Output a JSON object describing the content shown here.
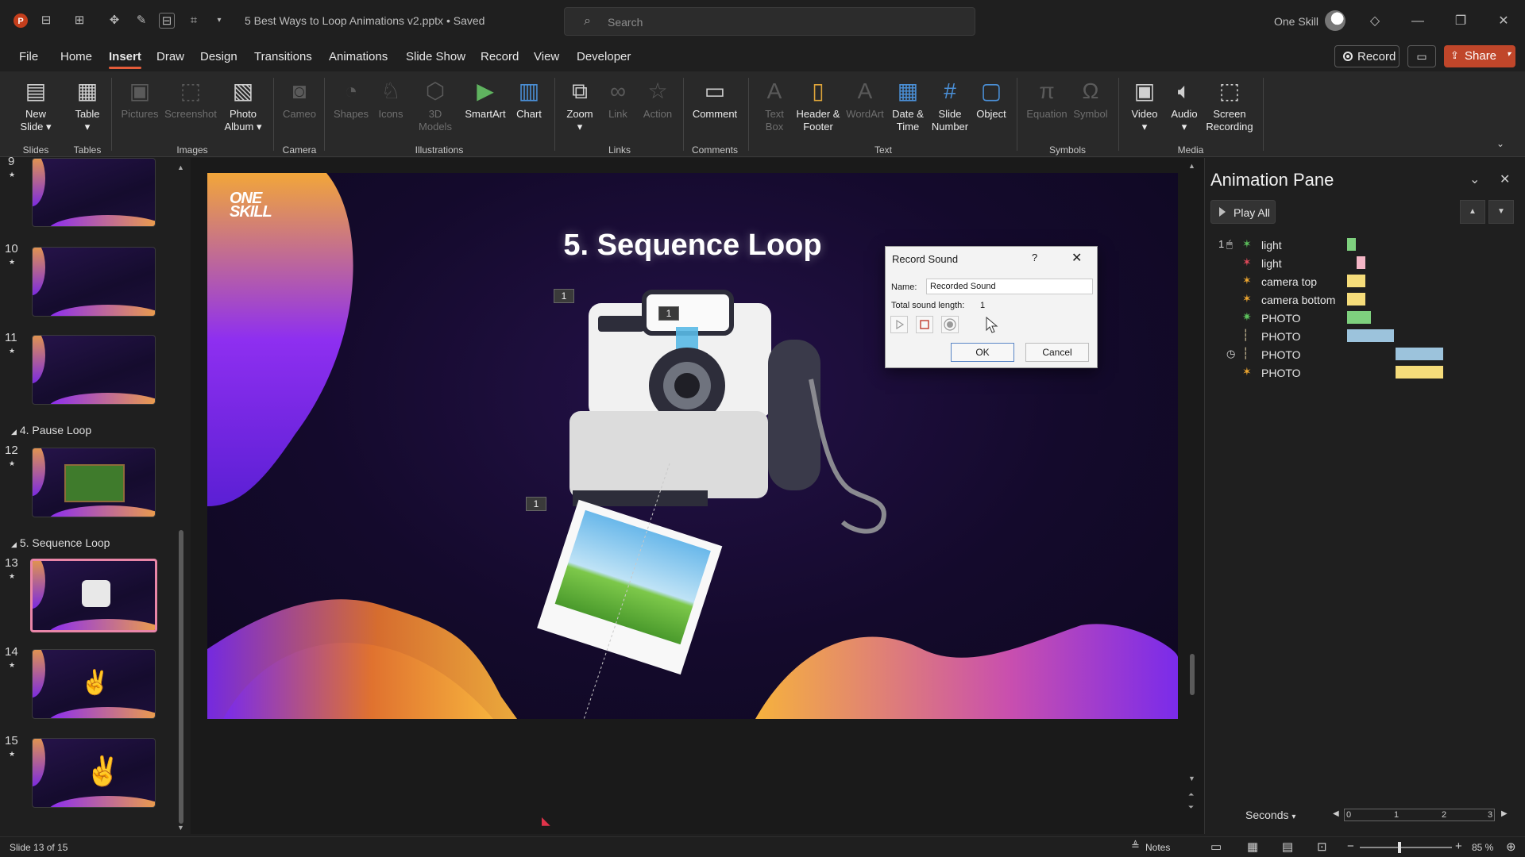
{
  "app": {
    "title": "5 Best Ways to Loop Animations v2.pptx • Saved",
    "search_placeholder": "Search",
    "user": "One Skill"
  },
  "menu": {
    "tabs": [
      "File",
      "Home",
      "Insert",
      "Draw",
      "Design",
      "Transitions",
      "Animations",
      "Slide Show",
      "Record",
      "View",
      "Developer"
    ],
    "active": "Insert",
    "record_label": "Record",
    "share_label": "Share"
  },
  "ribbon": {
    "buttons": [
      {
        "label": "New Slide",
        "icon": "new-slide-icon",
        "enabled": true
      },
      {
        "label": "Table",
        "icon": "table-icon",
        "enabled": true
      },
      {
        "label": "Pictures",
        "icon": "pictures-icon",
        "enabled": false
      },
      {
        "label": "Screenshot",
        "icon": "screenshot-icon",
        "enabled": false
      },
      {
        "label": "Photo Album",
        "icon": "photo-album-icon",
        "enabled": true
      },
      {
        "label": "Cameo",
        "icon": "cameo-icon",
        "enabled": false
      },
      {
        "label": "Shapes",
        "icon": "shapes-icon",
        "enabled": false
      },
      {
        "label": "Icons",
        "icon": "icons-icon",
        "enabled": false
      },
      {
        "label": "3D Models",
        "icon": "3d-models-icon",
        "enabled": false
      },
      {
        "label": "SmartArt",
        "icon": "smartart-icon",
        "enabled": true
      },
      {
        "label": "Chart",
        "icon": "chart-icon",
        "enabled": true
      },
      {
        "label": "Zoom",
        "icon": "zoom-icon",
        "enabled": true
      },
      {
        "label": "Link",
        "icon": "link-icon",
        "enabled": false
      },
      {
        "label": "Action",
        "icon": "action-icon",
        "enabled": false
      },
      {
        "label": "Comment",
        "icon": "comment-icon",
        "enabled": true
      },
      {
        "label": "Text Box",
        "icon": "text-box-icon",
        "enabled": false
      },
      {
        "label": "Header & Footer",
        "icon": "header-footer-icon",
        "enabled": true
      },
      {
        "label": "WordArt",
        "icon": "wordart-icon",
        "enabled": false
      },
      {
        "label": "Date & Time",
        "icon": "date-time-icon",
        "enabled": true
      },
      {
        "label": "Slide Number",
        "icon": "slide-number-icon",
        "enabled": true
      },
      {
        "label": "Object",
        "icon": "object-icon",
        "enabled": true
      },
      {
        "label": "Equation",
        "icon": "equation-icon",
        "enabled": false
      },
      {
        "label": "Symbol",
        "icon": "symbol-icon",
        "enabled": false
      },
      {
        "label": "Video",
        "icon": "video-icon",
        "enabled": true
      },
      {
        "label": "Audio",
        "icon": "audio-icon",
        "enabled": true
      },
      {
        "label": "Screen Recording",
        "icon": "screen-recording-icon",
        "enabled": true
      }
    ],
    "groups": [
      "Slides",
      "Tables",
      "Images",
      "Camera",
      "Illustrations",
      "Links",
      "Comments",
      "Text",
      "Symbols",
      "Media"
    ]
  },
  "slides_panel": {
    "items": [
      {
        "num": "9",
        "section": null
      },
      {
        "num": "10",
        "section": null
      },
      {
        "num": "11",
        "section": null
      },
      {
        "num": "12",
        "section": "4. Pause Loop"
      },
      {
        "num": "13",
        "section": "5. Sequence Loop",
        "selected": true
      },
      {
        "num": "14",
        "section": null
      },
      {
        "num": "15",
        "section": null
      }
    ]
  },
  "slide": {
    "title": "5. Sequence Loop",
    "logo_line1": "ONE",
    "logo_line2": "SKILL",
    "tag": "1"
  },
  "dialog": {
    "title": "Record Sound",
    "help": "?",
    "name_label": "Name:",
    "name_value": "Recorded Sound",
    "length_label": "Total sound length:",
    "length_value": "1",
    "ok": "OK",
    "cancel": "Cancel"
  },
  "animation_pane": {
    "title": "Animation Pane",
    "play_all": "Play All",
    "rows": [
      {
        "index": "1",
        "label": "light",
        "effect": "entrance",
        "color": "#7ed07e"
      },
      {
        "index": "",
        "label": "light",
        "effect": "exit",
        "color": "#f4b6c6"
      },
      {
        "index": "",
        "label": "camera top",
        "effect": "emphasis",
        "color": "#f5dc7a"
      },
      {
        "index": "",
        "label": "camera bottom",
        "effect": "emphasis",
        "color": "#f5dc7a"
      },
      {
        "index": "",
        "label": "PHOTO",
        "effect": "entrance",
        "color": "#7ed07e"
      },
      {
        "index": "",
        "label": "PHOTO",
        "effect": "motion",
        "color": "#9cc3dc"
      },
      {
        "index": "",
        "label": "PHOTO",
        "effect": "motion",
        "color": "#9cc3dc"
      },
      {
        "index": "",
        "label": "PHOTO",
        "effect": "emphasis",
        "color": "#f5dc7a"
      }
    ],
    "seconds_label": "Seconds",
    "timeline_ticks": [
      "0",
      "1",
      "2",
      "3"
    ]
  },
  "status": {
    "slide": "Slide 13 of 15",
    "notes": "Notes",
    "zoom": "85 %"
  },
  "colors": {
    "accent": "#e45c3a",
    "share": "#c0462a",
    "selected_thumb": "#e986a8"
  }
}
